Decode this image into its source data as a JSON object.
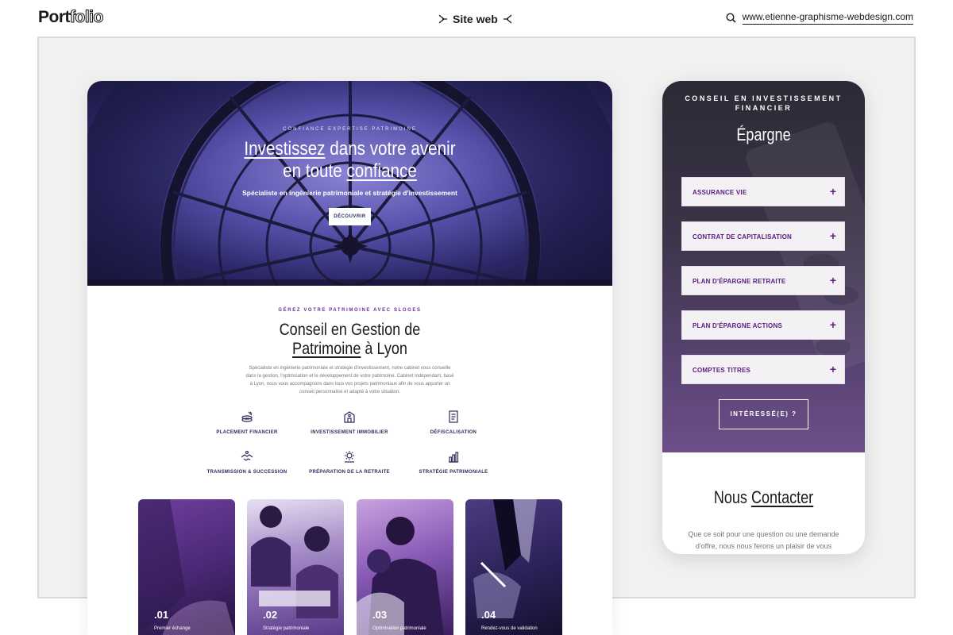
{
  "header": {
    "logo_strong": "Port",
    "logo_light": "folio",
    "center_title": "Site web",
    "site_url": "www.etienne-graphisme-webdesign.com"
  },
  "desktop": {
    "hero": {
      "kicker": "CONFIANCE EXPERTISE PATRIMOINE",
      "title_line1_u": "Investissez",
      "title_line1_rest": " dans votre avenir",
      "title_line2_pre": "en toute ",
      "title_line2_u": "confiance",
      "subtitle": "Spécialiste en ingénierie patrimoniale et stratégie d'investissement",
      "button": "DÉCOUVRIR"
    },
    "intro": {
      "kicker": "GÉREZ VOTRE PATRIMOINE AVEC SLOGES",
      "title_line1": "Conseil en Gestion de",
      "title_line2_u": "Patrimoine",
      "title_line2_rest": " à Lyon",
      "text": "Spécialiste en ingénierie patrimoniale et stratégie d'investissement, notre cabinet vous conseille dans la gestion, l'optimisation et le développement de votre patrimoine. Cabinet indépendant, basé à Lyon, nous vous accompagnons dans tous vos projets patrimoniaux afin de vous apporter un conseil personnalisé et adapté à votre situation."
    },
    "services": [
      {
        "label": "PLACEMENT FINANCIER",
        "icon": "coins-icon"
      },
      {
        "label": "INVESTISSEMENT IMMOBILIER",
        "icon": "building-icon"
      },
      {
        "label": "DÉFISCALISATION",
        "icon": "document-icon"
      },
      {
        "label": "TRANSMISSION & SUCCESSION",
        "icon": "handshake-icon"
      },
      {
        "label": "PRÉPARATION DE LA RETRAITE",
        "icon": "sun-icon"
      },
      {
        "label": "STRATÉGIE PATRIMONIALE",
        "icon": "chart-icon"
      }
    ],
    "cards": [
      {
        "num": ".01",
        "caption": "Premier échange"
      },
      {
        "num": ".02",
        "caption": "Stratégie patrimoniale"
      },
      {
        "num": ".03",
        "caption": "Optimisation patrimoniale"
      },
      {
        "num": ".04",
        "caption": "Rendez-vous de validation"
      }
    ]
  },
  "mobile": {
    "kicker": "CONSEIL EN INVESTISSEMENT FINANCIER",
    "title": "Épargne",
    "accordion": [
      {
        "label": "ASSURANCE VIE",
        "icon": "plus-icon"
      },
      {
        "label": "CONTRAT DE CAPITALISATION",
        "icon": "plus-icon"
      },
      {
        "label": "PLAN D'ÉPARGNE RETRAITE",
        "icon": "plus-icon"
      },
      {
        "label": "PLAN D'ÉPARGNE ACTIONS",
        "icon": "plus-icon"
      },
      {
        "label": "COMPTES TITRES",
        "icon": "plus-icon"
      }
    ],
    "plus_symbol": "+",
    "cta": "INTÉRESSÉ(E) ?",
    "contact_pre": "Nous ",
    "contact_u": "Contacter",
    "contact_text": "Que ce soit pour une question ou une demande d'offre, nous nous ferons un plaisir de vous"
  },
  "colors": {
    "accent": "#5a1b83",
    "hero_dark": "#141230",
    "hero_light": "#8b84d6",
    "frame_bg": "#f1f1f1"
  }
}
